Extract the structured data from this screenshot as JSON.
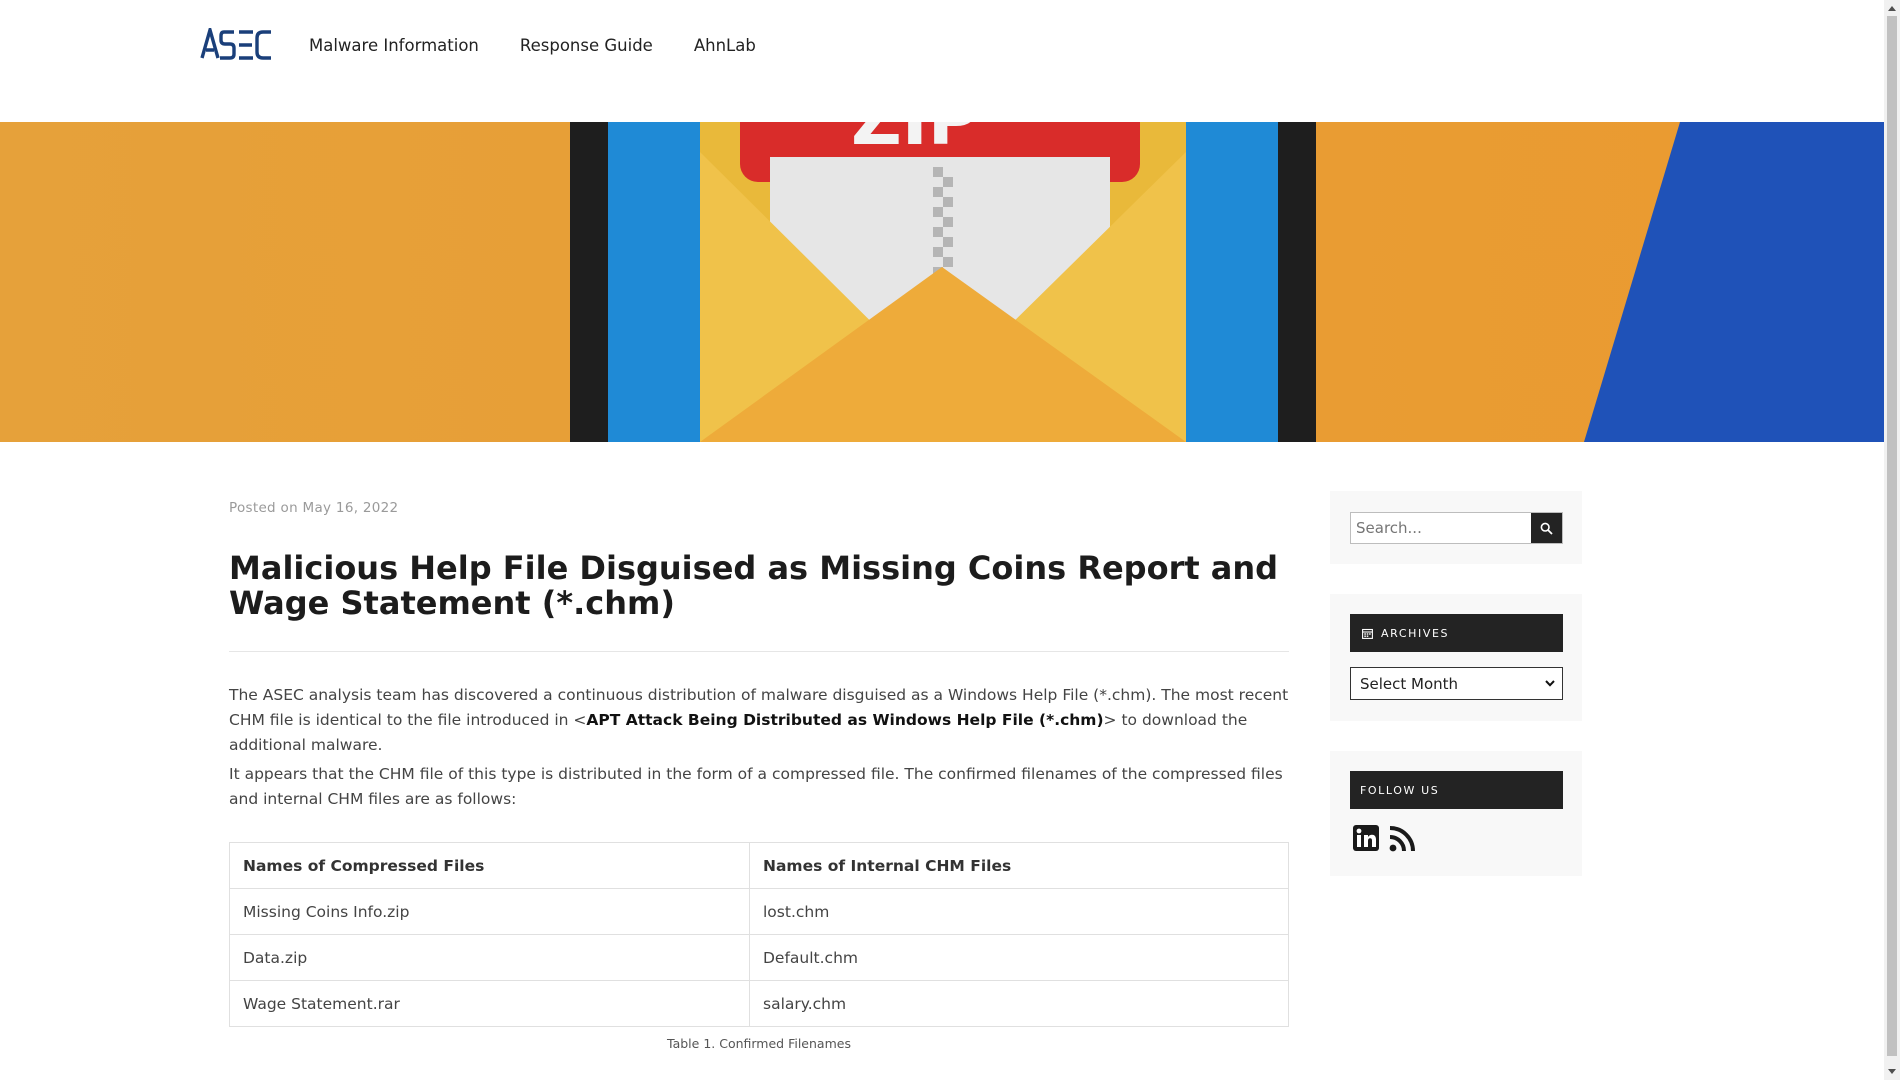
{
  "header": {
    "logo_text": "ASEC",
    "nav": [
      {
        "label": "Malware Information"
      },
      {
        "label": "Response Guide"
      },
      {
        "label": "AhnLab"
      }
    ]
  },
  "banner": {
    "badge_text": "ZIP",
    "colors": {
      "background": "#e8a23a",
      "blue": "#1e8bd8",
      "envelope": "#e9b93a",
      "red": "#d92c2a"
    }
  },
  "article": {
    "posted_prefix": "Posted on",
    "posted_date": "May 16, 2022",
    "title": "Malicious Help File Disguised as Missing Coins Report and Wage Statement (*.chm)",
    "para1_before": "The ASEC analysis team has discovered a continuous distribution of malware disguised as a Windows Help File (*.chm). The most recent CHM file is identical to the file introduced in <",
    "para1_link": "APT Attack Being Distributed as Windows Help File (*.chm)",
    "para1_after": "> to download the additional malware.",
    "para2": "It appears that the CHM file of this type is distributed in the form of a compressed file. The confirmed filenames of the compressed files and internal CHM files are as follows:",
    "table": {
      "headers": [
        "Names of Compressed Files",
        "Names of Internal CHM Files"
      ],
      "rows": [
        [
          "Missing Coins Info.zip",
          "lost.chm"
        ],
        [
          "Data.zip",
          "Default.chm"
        ],
        [
          "Wage Statement.rar",
          "salary.chm"
        ]
      ],
      "caption": "Table 1. Confirmed Filenames"
    }
  },
  "sidebar": {
    "search_placeholder": "Search...",
    "search_icon": "search-icon",
    "archives_title": "ARCHIVES",
    "archives_icon": "calendar-icon",
    "archives_select": "Select Month",
    "follow_title": "FOLLOW US",
    "social": [
      {
        "name": "linkedin-icon"
      },
      {
        "name": "rss-icon"
      }
    ]
  }
}
